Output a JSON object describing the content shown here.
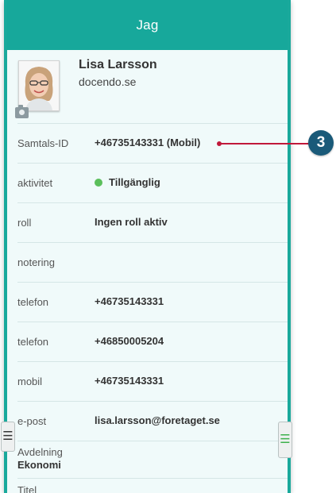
{
  "header": {
    "title": "Jag"
  },
  "profile": {
    "name": "Lisa Larsson",
    "domain": "docendo.se"
  },
  "rows": [
    {
      "label": "Samtals-ID",
      "value": "+46735143331 (Mobil)"
    },
    {
      "label": "aktivitet",
      "value": "Tillgänglig",
      "status_color": "#5bbf5b"
    },
    {
      "label": "roll",
      "value": "Ingen roll aktiv"
    },
    {
      "label": "notering",
      "value": ""
    },
    {
      "label": "telefon",
      "value": "+46735143331"
    },
    {
      "label": "telefon",
      "value": "+46850005204"
    },
    {
      "label": "mobil",
      "value": "+46735143331"
    },
    {
      "label": "e-post",
      "value": "lisa.larsson@foretaget.se"
    }
  ],
  "department": {
    "label": "Avdelning",
    "value": "Ekonomi"
  },
  "title_row": {
    "label": "Titel"
  },
  "callout": {
    "number": "3"
  },
  "colors": {
    "accent": "#17a89b",
    "callout_line": "#c0183a",
    "badge": "#1a5a79"
  },
  "icons": {
    "camera": "camera-icon",
    "menu_left": "hamburger-icon",
    "menu_right": "hamburger-icon"
  }
}
